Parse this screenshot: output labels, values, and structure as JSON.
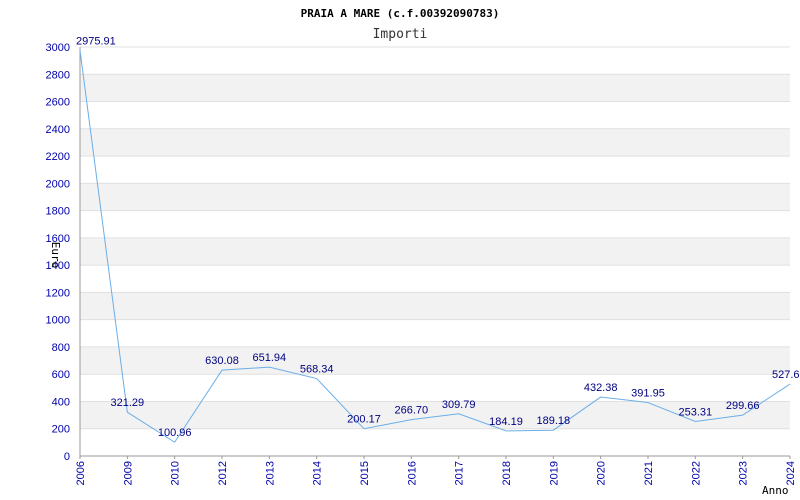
{
  "chart_data": {
    "type": "line",
    "title": "PRAIA A MARE (c.f.00392090783)",
    "subtitle": "Importi",
    "xlabel": "Anno",
    "ylabel": "Euro",
    "categories": [
      "2006",
      "2009",
      "2010",
      "2012",
      "2013",
      "2014",
      "2015",
      "2016",
      "2017",
      "2018",
      "2019",
      "2020",
      "2021",
      "2022",
      "2023",
      "2024"
    ],
    "values": [
      2975.91,
      321.29,
      100.96,
      630.08,
      651.94,
      568.34,
      200.17,
      266.7,
      309.79,
      184.19,
      189.18,
      432.38,
      391.95,
      253.31,
      299.66,
      527.6
    ],
    "data_labels": [
      "2975.91",
      "321.29",
      "100.96",
      "630.08",
      "651.94",
      "568.34",
      "200.17",
      "266.70",
      "309.79",
      "184.19",
      "189.18",
      "432.38",
      "391.95",
      "253.31",
      "299.66",
      "527.6"
    ],
    "ylim": [
      0,
      3000
    ],
    "yticks": [
      0,
      200,
      400,
      600,
      800,
      1000,
      1200,
      1400,
      1600,
      1800,
      2000,
      2200,
      2400,
      2600,
      2800,
      3000
    ],
    "grid": "horizontal alternating bands",
    "colors": {
      "line": "#6aaee8",
      "band": "#f2f2f2",
      "tick_text": "#0000aa",
      "label_text": "#000080"
    }
  }
}
